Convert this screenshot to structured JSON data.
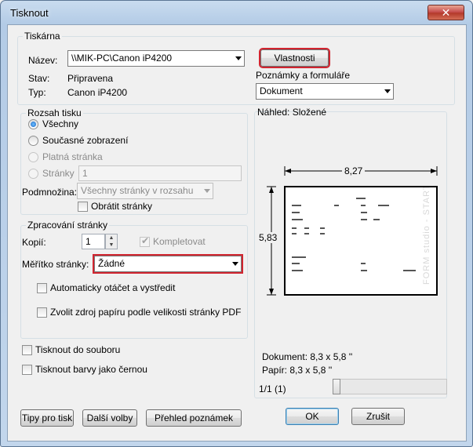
{
  "window": {
    "title": "Tisknout",
    "close_glyph": "✕"
  },
  "printer": {
    "group_label": "Tiskárna",
    "name_label": "Název:",
    "name_value": "\\\\MIK-PC\\Canon iP4200",
    "properties_button": "Vlastnosti",
    "status_label": "Stav:",
    "status_value": "Připravena",
    "type_label": "Typ:",
    "type_value": "Canon iP4200",
    "comments_label": "Poznámky a formuláře",
    "comments_value": "Dokument"
  },
  "range": {
    "group_label": "Rozsah tisku",
    "all": "Všechny",
    "current_view": "Současné zobrazení",
    "current_page": "Platná stránka",
    "pages": "Stránky",
    "pages_value": "1",
    "subset_label": "Podmnožina:",
    "subset_value": "Všechny stránky v rozsahu",
    "reverse": "Obrátit stránky"
  },
  "handling": {
    "group_label": "Zpracování stránky",
    "copies_label": "Kopií:",
    "copies_value": "1",
    "collate": "Kompletovat",
    "scaling_label": "Měřítko stránky:",
    "scaling_value": "Žádné",
    "auto_rotate": "Automaticky otáčet a vystředit",
    "choose_source": "Zvolit zdroj papíru podle velikosti stránky PDF"
  },
  "options": {
    "print_to_file": "Tisknout do souboru",
    "print_bw": "Tisknout barvy jako černou"
  },
  "preview": {
    "label": "Náhled: Složené",
    "width_value": "8,27",
    "height_value": "5,83",
    "document_size": "Dokument: 8,3 x 5,8 ''",
    "paper_size": "Papír: 8,3 x 5,8 ''",
    "page_counter": "1/1 (1)",
    "page_position": 0.0
  },
  "buttons": {
    "tips": "Tipy pro tisk",
    "advanced": "Další volby",
    "summarize": "Přehled poznámek",
    "ok": "OK",
    "cancel": "Zrušit"
  },
  "colors": {
    "highlight": "#d1242f"
  }
}
